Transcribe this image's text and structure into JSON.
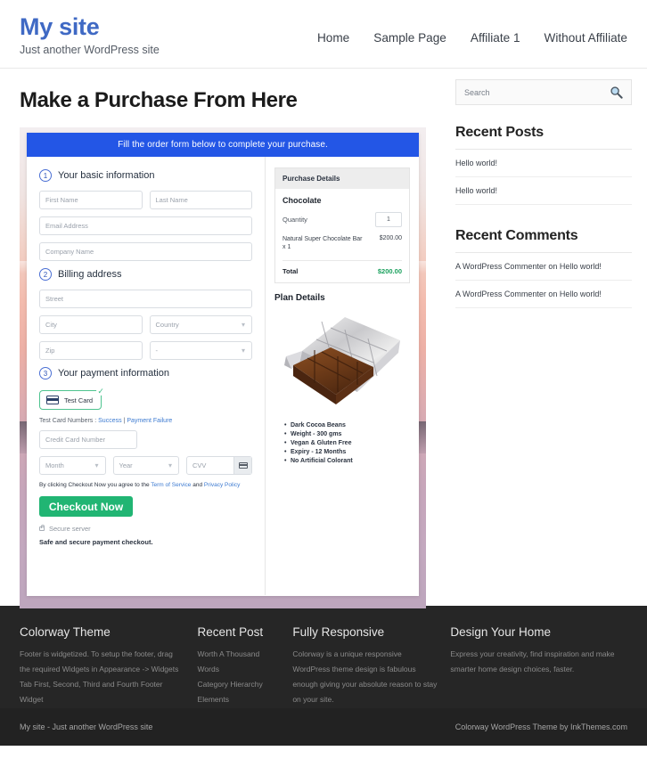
{
  "header": {
    "site_title": "My site",
    "tagline": "Just another WordPress site",
    "nav": [
      {
        "label": "Home"
      },
      {
        "label": "Sample Page"
      },
      {
        "label": "Affiliate 1"
      },
      {
        "label": "Without Affiliate"
      }
    ]
  },
  "main": {
    "page_title": "Make a Purchase From Here",
    "order_form": {
      "banner": "Fill the order form below to complete your purchase.",
      "step1": {
        "number": "1",
        "label": "Your basic information",
        "first_name_placeholder": "First Name",
        "last_name_placeholder": "Last Name",
        "email_placeholder": "Email Address",
        "company_placeholder": "Company Name"
      },
      "step2": {
        "number": "2",
        "label": "Billing address",
        "street_placeholder": "Street",
        "city_placeholder": "City",
        "country_placeholder": "Country",
        "zip_placeholder": "Zip",
        "state_placeholder": "-"
      },
      "step3": {
        "number": "3",
        "label": "Your payment information",
        "card_chip_label": "Test  Card",
        "card_chip_check": "✓",
        "test_card_prefix": "Test Card Numbers : ",
        "test_card_success": "Success",
        "test_card_separator": " | ",
        "test_card_failure": "Payment Failure",
        "card_number_placeholder": "Credit Card Number",
        "month_placeholder": "Month",
        "year_placeholder": "Year",
        "cvv_placeholder": "CVV",
        "terms_prefix": "By clicking Checkout Now you agree to the ",
        "terms_link1": "Term of Service",
        "terms_mid": " and ",
        "terms_link2": "Privacy Policy",
        "checkout_label": "Checkout Now",
        "secure_server": "Secure server",
        "safe_note": "Safe and secure payment checkout."
      },
      "purchase_details": {
        "heading": "Purchase Details",
        "product_name": "Chocolate",
        "quantity_label": "Quantity",
        "quantity_value": "1",
        "line_item_desc": "Natural Super Chocolate Bar x 1",
        "line_item_price": "$200.00",
        "total_label": "Total",
        "total_value": "$200.00"
      },
      "plan_details": {
        "heading": "Plan Details",
        "features": [
          "Dark Cocoa Beans",
          "Weight - 300 gms",
          "Vegan & Gluten Free",
          "Expiry - 12 Months",
          "No Artificial Colorant"
        ]
      }
    }
  },
  "sidebar": {
    "search_placeholder": "Search",
    "recent_posts": {
      "title": "Recent Posts",
      "items": [
        {
          "label": "Hello world!"
        },
        {
          "label": "Hello world!"
        }
      ]
    },
    "recent_comments": {
      "title": "Recent Comments",
      "items": [
        {
          "label": "A WordPress Commenter on Hello world!"
        },
        {
          "label": "A WordPress Commenter on Hello world!"
        }
      ]
    }
  },
  "footer": {
    "columns": [
      {
        "title": "Colorway Theme",
        "text": "Footer is widgetized. To setup the footer, drag the required Widgets in Appearance -> Widgets Tab First, Second, Third and Fourth Footer Widget",
        "items": []
      },
      {
        "title": "Recent Post",
        "text": "",
        "items": [
          {
            "label": "Worth A Thousand Words"
          },
          {
            "label": "Category Hierarchy"
          },
          {
            "label": "Elements"
          }
        ]
      },
      {
        "title": "Fully Responsive",
        "text": "Colorway is a unique responsive WordPress theme design is fabulous enough giving your absolute reason to stay on your site.",
        "items": []
      },
      {
        "title": "Design Your Home",
        "text": "Express your creativity, find inspiration and make smarter home design choices, faster.",
        "items": []
      }
    ],
    "bottom_left": "My site - Just another WordPress site",
    "bottom_right": "Colorway WordPress Theme by InkThemes.com"
  },
  "colors": {
    "brand_blue": "#3f69c4",
    "banner_blue": "#2356e6",
    "checkout_green": "#21b573",
    "total_green": "#19a05c",
    "footer_dark": "#262626"
  }
}
